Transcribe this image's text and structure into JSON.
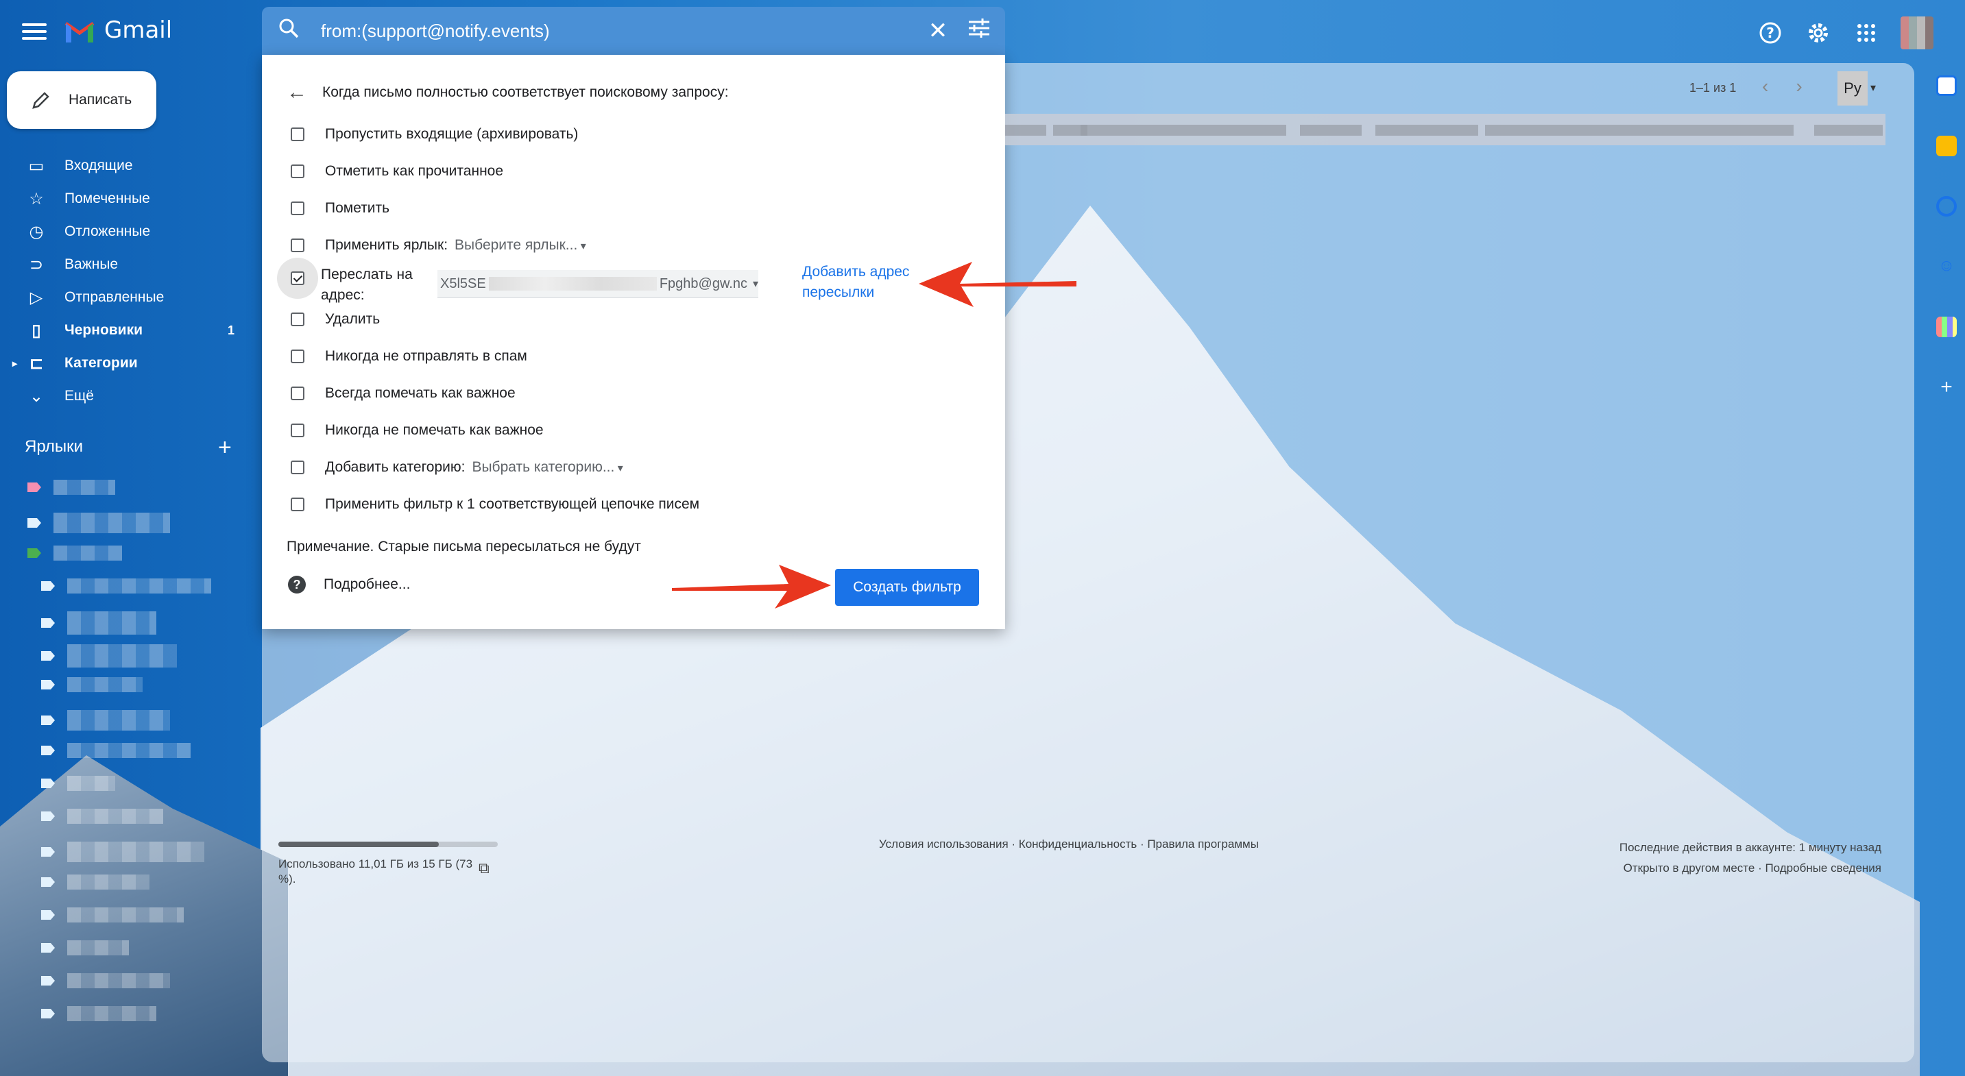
{
  "app": {
    "name": "Gmail"
  },
  "search": {
    "value": "from:(support@notify.events)"
  },
  "compose": {
    "label": "Написать"
  },
  "nav": {
    "items": [
      {
        "label": "Входящие",
        "count": ""
      },
      {
        "label": "Помеченные",
        "count": ""
      },
      {
        "label": "Отложенные",
        "count": ""
      },
      {
        "label": "Важные",
        "count": ""
      },
      {
        "label": "Отправленные",
        "count": ""
      },
      {
        "label": "Черновики",
        "count": "1"
      },
      {
        "label": "Категории",
        "count": ""
      },
      {
        "label": "Ещё",
        "count": ""
      }
    ]
  },
  "labels": {
    "title": "Ярлыки",
    "add": "+"
  },
  "filter": {
    "header": "Когда письмо полностью соответствует поисковому запросу:",
    "options": [
      {
        "label": "Пропустить входящие (архивировать)",
        "checked": false
      },
      {
        "label": "Отметить как прочитанное",
        "checked": false
      },
      {
        "label": "Пометить",
        "checked": false
      },
      {
        "label": "Применить ярлык:",
        "checked": false,
        "dropdown": "Выберите ярлык..."
      },
      {
        "label": "Переслать на адрес:",
        "checked": true
      },
      {
        "label": "Удалить",
        "checked": false
      },
      {
        "label": "Никогда не отправлять в спам",
        "checked": false
      },
      {
        "label": "Всегда помечать как важное",
        "checked": false
      },
      {
        "label": "Никогда не помечать как важное",
        "checked": false
      },
      {
        "label": "Добавить категорию:",
        "checked": false,
        "dropdown": "Выбрать категорию..."
      },
      {
        "label": "Применить фильтр к 1 соответствующей цепочке писем",
        "checked": false
      }
    ],
    "forward_line1": "Переслать на",
    "forward_line2": "адрес:",
    "forward_address_start": "X5l5SE",
    "forward_address_end": "Fpghb@gw.nc",
    "add_forward_line1": "Добавить адрес",
    "add_forward_line2": "пересылки",
    "note": "Примечание. Старые письма пересылаться не будут",
    "more": "Подробнее...",
    "create_button": "Создать фильтр"
  },
  "pager": {
    "text": "1–1 из 1",
    "lang": "Ру"
  },
  "storage": {
    "text": "Использовано 11,01 ГБ из 15 ГБ (73 %).",
    "percent": 73
  },
  "footer": {
    "links": "Условия использования · Конфиденциальность · Правила программы",
    "activity_line1": "Последние действия в аккаунте: 1 минуту назад",
    "activity_line2": "Открыто в другом месте · Подробные сведения"
  },
  "colors": {
    "accent": "#1a73e8",
    "arrow": "#e8361f"
  }
}
